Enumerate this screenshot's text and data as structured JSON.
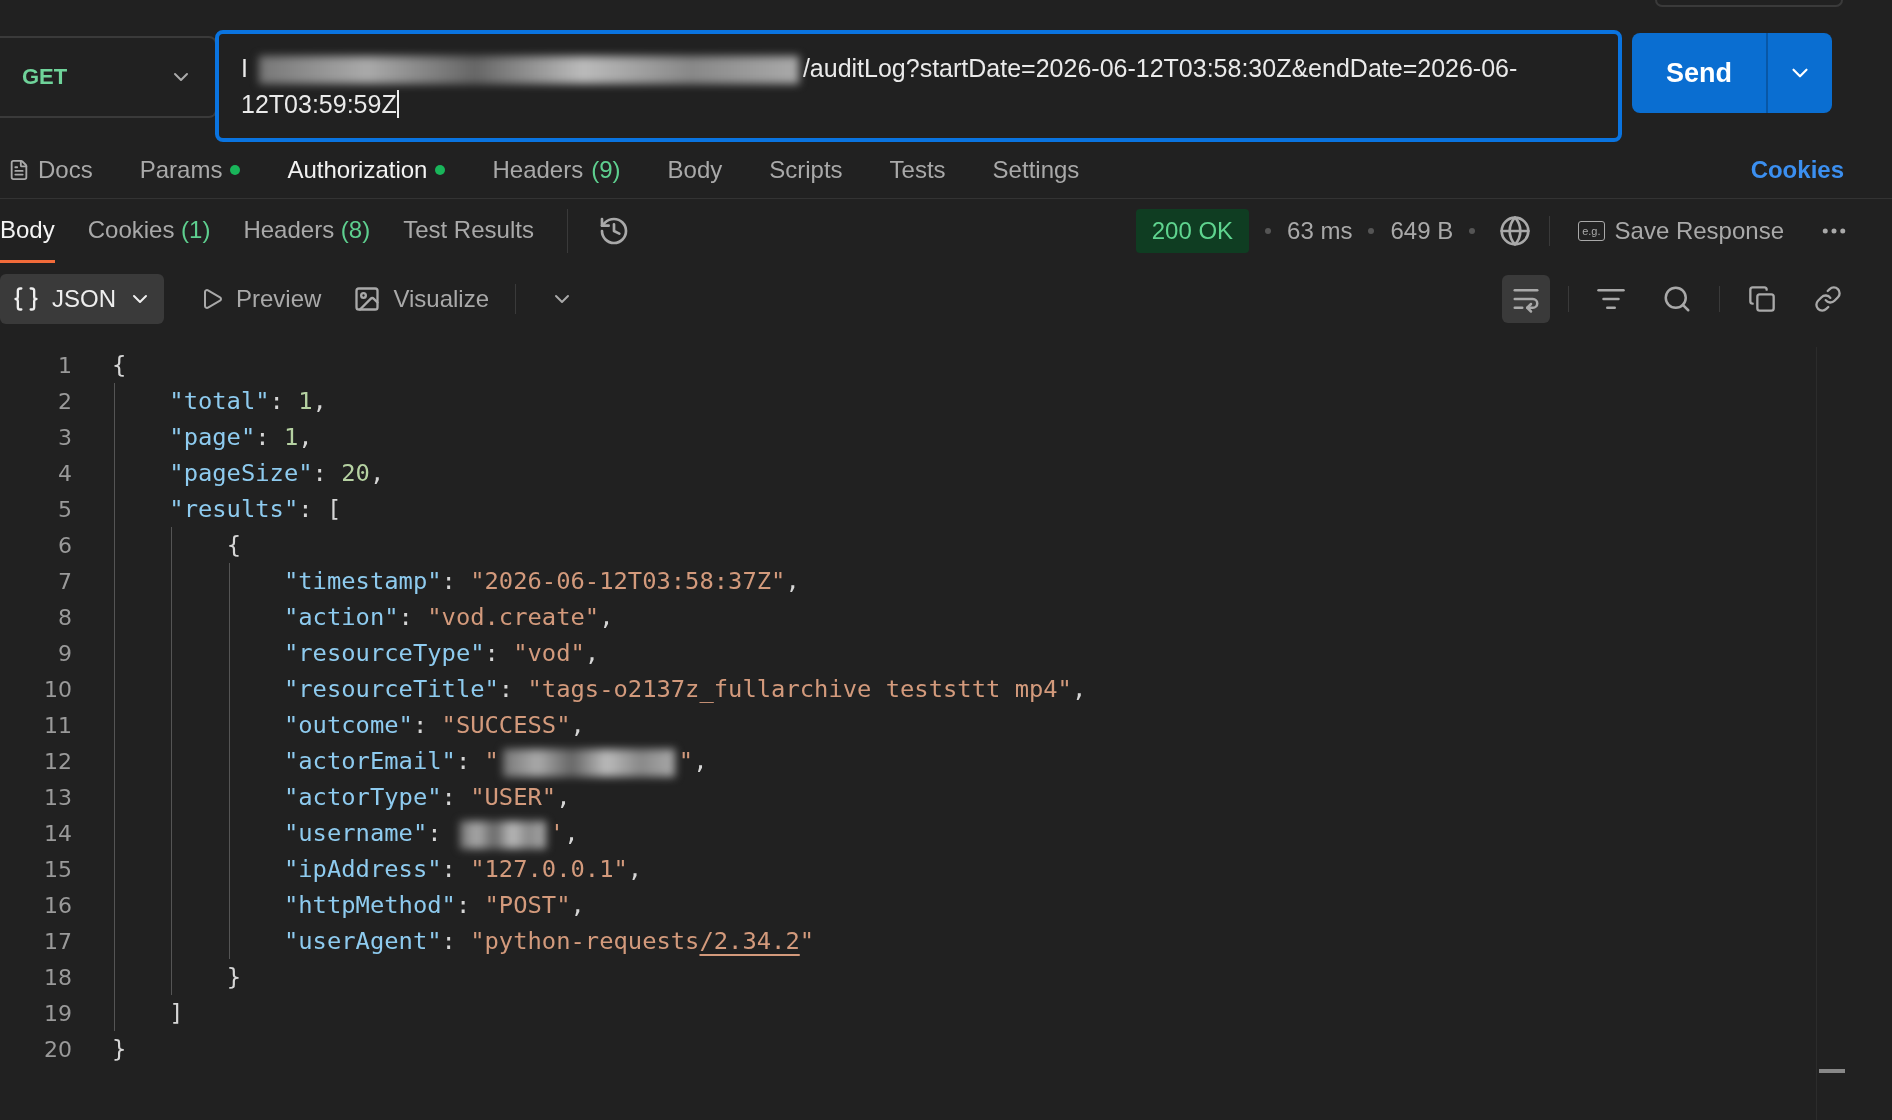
{
  "request": {
    "method": "GET",
    "url": {
      "prefix": "I",
      "redacted": true,
      "value": "/auditLog?startDate=2026-06-12T03:58:30Z&endDate=2026-06-12T03:59:59Z"
    },
    "send": "Send"
  },
  "request_tabs": [
    {
      "label": "Docs",
      "kind": "docs",
      "selected": false
    },
    {
      "label": "Params",
      "kind": "dot",
      "selected": false
    },
    {
      "label": "Authorization",
      "kind": "dot",
      "selected": true
    },
    {
      "label": "Headers",
      "count": "(9)",
      "kind": "count",
      "selected": false
    },
    {
      "label": "Body",
      "kind": "plain",
      "selected": false
    },
    {
      "label": "Scripts",
      "kind": "plain",
      "selected": false
    },
    {
      "label": "Tests",
      "kind": "plain",
      "selected": false
    },
    {
      "label": "Settings",
      "kind": "plain",
      "selected": false
    }
  ],
  "cookies_link": "Cookies",
  "response_tabs": [
    {
      "label": "Body",
      "selected": true
    },
    {
      "label": "Cookies",
      "count": "(1)",
      "selected": false
    },
    {
      "label": "Headers",
      "count": "(8)",
      "selected": false
    },
    {
      "label": "Test Results",
      "selected": false
    }
  ],
  "status": {
    "code": "200 OK",
    "time": "63 ms",
    "size": "649 B",
    "save_icon": "e.g.",
    "save": "Save Response"
  },
  "view": {
    "format": "JSON",
    "preview": "Preview",
    "visualize": "Visualize",
    "wrap_on": true
  },
  "code": [
    {
      "number": "1",
      "tokens": [
        {
          "kind": "punct",
          "text": "{"
        }
      ],
      "children": [
        {
          "number": "2",
          "tokens": [
            {
              "kind": "key",
              "text": "\"total\""
            },
            {
              "kind": "punct",
              "text": ": "
            },
            {
              "kind": "number",
              "text": "1"
            },
            {
              "kind": "punct",
              "text": ","
            }
          ]
        },
        {
          "number": "3",
          "tokens": [
            {
              "kind": "key",
              "text": "\"page\""
            },
            {
              "kind": "punct",
              "text": ": "
            },
            {
              "kind": "number",
              "text": "1"
            },
            {
              "kind": "punct",
              "text": ","
            }
          ]
        },
        {
          "number": "4",
          "tokens": [
            {
              "kind": "key",
              "text": "\"pageSize\""
            },
            {
              "kind": "punct",
              "text": ": "
            },
            {
              "kind": "number",
              "text": "20"
            },
            {
              "kind": "punct",
              "text": ","
            }
          ]
        },
        {
          "number": "5",
          "tokens": [
            {
              "kind": "key",
              "text": "\"results\""
            },
            {
              "kind": "punct",
              "text": ": ["
            }
          ],
          "children": [
            {
              "number": "6",
              "tokens": [
                {
                  "kind": "punct",
                  "text": "{"
                }
              ],
              "children": [
                {
                  "number": "7",
                  "tokens": [
                    {
                      "kind": "key",
                      "text": "\"timestamp\""
                    },
                    {
                      "kind": "punct",
                      "text": ": "
                    },
                    {
                      "kind": "string",
                      "text": "\"2026-06-12T03:58:37Z\""
                    },
                    {
                      "kind": "punct",
                      "text": ","
                    }
                  ]
                },
                {
                  "number": "8",
                  "tokens": [
                    {
                      "kind": "key",
                      "text": "\"action\""
                    },
                    {
                      "kind": "punct",
                      "text": ": "
                    },
                    {
                      "kind": "string",
                      "text": "\"vod.create\""
                    },
                    {
                      "kind": "punct",
                      "text": ","
                    }
                  ]
                },
                {
                  "number": "9",
                  "tokens": [
                    {
                      "kind": "key",
                      "text": "\"resourceType\""
                    },
                    {
                      "kind": "punct",
                      "text": ": "
                    },
                    {
                      "kind": "string",
                      "text": "\"vod\""
                    },
                    {
                      "kind": "punct",
                      "text": ","
                    }
                  ]
                },
                {
                  "number": "10",
                  "tokens": [
                    {
                      "kind": "key",
                      "text": "\"resourceTitle\""
                    },
                    {
                      "kind": "punct",
                      "text": ": "
                    },
                    {
                      "kind": "string",
                      "text": "\"tags-o2137z_fullarchive teststtt mp4\""
                    },
                    {
                      "kind": "punct",
                      "text": ","
                    }
                  ]
                },
                {
                  "number": "11",
                  "tokens": [
                    {
                      "kind": "key",
                      "text": "\"outcome\""
                    },
                    {
                      "kind": "punct",
                      "text": ": "
                    },
                    {
                      "kind": "string",
                      "text": "\"SUCCESS\""
                    },
                    {
                      "kind": "punct",
                      "text": ","
                    }
                  ]
                },
                {
                  "number": "12",
                  "tokens": [
                    {
                      "kind": "key",
                      "text": "\"actorEmail\""
                    },
                    {
                      "kind": "punct",
                      "text": ": "
                    },
                    {
                      "kind": "string",
                      "text": "\""
                    },
                    {
                      "kind": "redacted"
                    },
                    {
                      "kind": "string",
                      "text": "\""
                    },
                    {
                      "kind": "punct",
                      "text": ","
                    }
                  ]
                },
                {
                  "number": "13",
                  "tokens": [
                    {
                      "kind": "key",
                      "text": "\"actorType\""
                    },
                    {
                      "kind": "punct",
                      "text": ": "
                    },
                    {
                      "kind": "string",
                      "text": "\"USER\""
                    },
                    {
                      "kind": "punct",
                      "text": ","
                    }
                  ]
                },
                {
                  "number": "14",
                  "tokens": [
                    {
                      "kind": "key",
                      "text": "\"username\""
                    },
                    {
                      "kind": "punct",
                      "text": ": "
                    },
                    {
                      "kind": "redacted"
                    },
                    {
                      "kind": "string",
                      "text": "'"
                    },
                    {
                      "kind": "punct",
                      "text": ","
                    }
                  ]
                },
                {
                  "number": "15",
                  "tokens": [
                    {
                      "kind": "key",
                      "text": "\"ipAddress\""
                    },
                    {
                      "kind": "punct",
                      "text": ": "
                    },
                    {
                      "kind": "string",
                      "text": "\"127.0.0.1\""
                    },
                    {
                      "kind": "punct",
                      "text": ","
                    }
                  ]
                },
                {
                  "number": "16",
                  "tokens": [
                    {
                      "kind": "key",
                      "text": "\"httpMethod\""
                    },
                    {
                      "kind": "punct",
                      "text": ": "
                    },
                    {
                      "kind": "string",
                      "text": "\"POST\""
                    },
                    {
                      "kind": "punct",
                      "text": ","
                    }
                  ]
                },
                {
                  "number": "17",
                  "tokens": [
                    {
                      "kind": "key",
                      "text": "\"userAgent\""
                    },
                    {
                      "kind": "punct",
                      "text": ": "
                    },
                    {
                      "kind": "string",
                      "text": "\"python-requests"
                    },
                    {
                      "kind": "link",
                      "text": "/2.34.2"
                    },
                    {
                      "kind": "string",
                      "text": "\""
                    }
                  ]
                }
              ]
            },
            {
              "number": "18",
              "tokens": [
                {
                  "kind": "punct",
                  "text": "}"
                }
              ]
            }
          ]
        },
        {
          "number": "19",
          "tokens": [
            {
              "kind": "punct",
              "text": "]"
            }
          ]
        }
      ]
    },
    {
      "number": "20",
      "tokens": [
        {
          "kind": "punct",
          "text": "}"
        }
      ]
    }
  ]
}
